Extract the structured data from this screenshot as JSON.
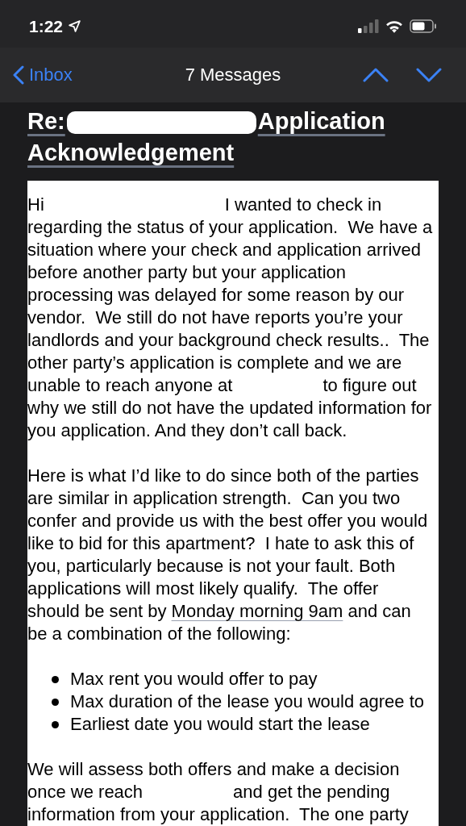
{
  "status_bar": {
    "time": "1:22"
  },
  "nav_bar": {
    "back_label": "Inbox",
    "title": "7 Messages"
  },
  "subject": {
    "prefix": "Re:",
    "rest": "Application Acknowledgement"
  },
  "body": {
    "paragraphs": [
      {
        "kind": "text",
        "lines": [
          [
            {
              "kind": "text",
              "text": "Hi"
            },
            {
              "kind": "gap"
            },
            {
              "kind": "gap"
            },
            {
              "kind": "text",
              "text": "I wanted to check in"
            }
          ],
          [
            {
              "kind": "text",
              "text": "regarding the status of your application.  We have a"
            }
          ],
          [
            {
              "kind": "text",
              "text": "situation where your check and application arrived"
            }
          ],
          [
            {
              "kind": "text",
              "text": "before another party but your application"
            }
          ],
          [
            {
              "kind": "text",
              "text": "processing was delayed for some reason by our"
            }
          ],
          [
            {
              "kind": "text",
              "text": "vendor.  We still do not have reports you’re your"
            }
          ],
          [
            {
              "kind": "text",
              "text": "landlords and your background check results..  The"
            }
          ],
          [
            {
              "kind": "text",
              "text": "other party’s application is complete and we are"
            }
          ],
          [
            {
              "kind": "text",
              "text": "unable to reach anyone at"
            },
            {
              "kind": "gap"
            },
            {
              "kind": "text",
              "text": "to figure out"
            }
          ],
          [
            {
              "kind": "text",
              "text": "why we still do not have the updated information for"
            }
          ],
          [
            {
              "kind": "text",
              "text": "you application. And they don’t call back."
            }
          ]
        ]
      },
      {
        "kind": "text",
        "lines": [
          [
            {
              "kind": "text",
              "text": "Here is what I’d like to do since both of the parties"
            }
          ],
          [
            {
              "kind": "text",
              "text": "are similar in application strength.  Can you two"
            }
          ],
          [
            {
              "kind": "text",
              "text": "confer and provide us with the best offer you would"
            }
          ],
          [
            {
              "kind": "text",
              "text": "like to bid for this apartment?  I hate to ask this of"
            }
          ],
          [
            {
              "kind": "text",
              "text": "you, particularly because is not your fault. Both"
            }
          ],
          [
            {
              "kind": "text",
              "text": "applications will most likely qualify.  The offer"
            }
          ],
          [
            {
              "kind": "text",
              "text": "should be sent by "
            },
            {
              "kind": "date_link",
              "text": "Monday morning 9am"
            },
            {
              "kind": "text",
              "text": " and can"
            }
          ],
          [
            {
              "kind": "text",
              "text": "be a combination of the following:"
            }
          ]
        ]
      },
      {
        "kind": "bullets",
        "items": [
          "Max rent you would offer to pay",
          "Max duration of the lease you would agree to",
          "Earliest date you would start the lease"
        ]
      },
      {
        "kind": "text",
        "lines": [
          [
            {
              "kind": "text",
              "text": "We will assess both offers and make a decision"
            }
          ],
          [
            {
              "kind": "text",
              "text": "once we reach"
            },
            {
              "kind": "gap"
            },
            {
              "kind": "text",
              "text": "and get the pending"
            }
          ],
          [
            {
              "kind": "text",
              "text": "information from your application.  The one party"
            }
          ]
        ]
      }
    ]
  }
}
